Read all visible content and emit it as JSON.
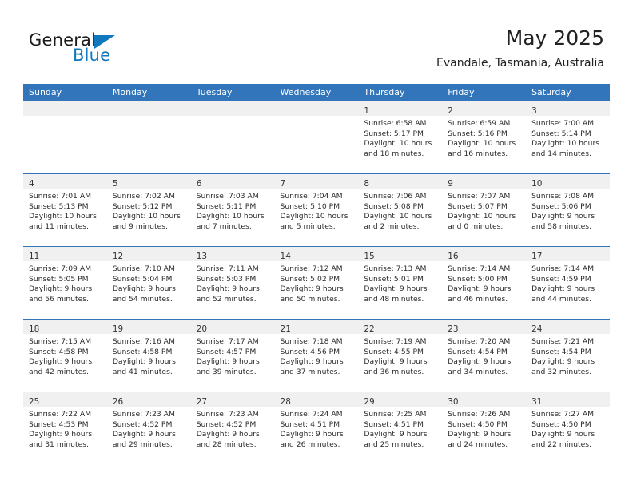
{
  "brand": {
    "name_top": "General",
    "name_bottom": "Blue",
    "accent_color": "#1278be",
    "triangle_icon": "triangle-logo-icon"
  },
  "header": {
    "title": "May 2025",
    "subtitle": "Evandale, Tasmania, Australia"
  },
  "theme": {
    "header_bg": "#3275ba",
    "header_text": "#ffffff",
    "daynum_band_bg": "#f0f0f0",
    "cell_bg": "#ffffff",
    "week_separator": "#3275ba"
  },
  "weekday_headers": [
    "Sunday",
    "Monday",
    "Tuesday",
    "Wednesday",
    "Thursday",
    "Friday",
    "Saturday"
  ],
  "labels": {
    "sunrise_prefix": "Sunrise: ",
    "sunset_prefix": "Sunset: ",
    "daylight_prefix": "Daylight: "
  },
  "weeks": [
    [
      {
        "day": "",
        "empty": true
      },
      {
        "day": "",
        "empty": true
      },
      {
        "day": "",
        "empty": true
      },
      {
        "day": "",
        "empty": true
      },
      {
        "day": "1",
        "sunrise": "Sunrise: 6:58 AM",
        "sunset": "Sunset: 5:17 PM",
        "daylight_1": "Daylight: 10 hours",
        "daylight_2": "and 18 minutes."
      },
      {
        "day": "2",
        "sunrise": "Sunrise: 6:59 AM",
        "sunset": "Sunset: 5:16 PM",
        "daylight_1": "Daylight: 10 hours",
        "daylight_2": "and 16 minutes."
      },
      {
        "day": "3",
        "sunrise": "Sunrise: 7:00 AM",
        "sunset": "Sunset: 5:14 PM",
        "daylight_1": "Daylight: 10 hours",
        "daylight_2": "and 14 minutes."
      }
    ],
    [
      {
        "day": "4",
        "sunrise": "Sunrise: 7:01 AM",
        "sunset": "Sunset: 5:13 PM",
        "daylight_1": "Daylight: 10 hours",
        "daylight_2": "and 11 minutes."
      },
      {
        "day": "5",
        "sunrise": "Sunrise: 7:02 AM",
        "sunset": "Sunset: 5:12 PM",
        "daylight_1": "Daylight: 10 hours",
        "daylight_2": "and 9 minutes."
      },
      {
        "day": "6",
        "sunrise": "Sunrise: 7:03 AM",
        "sunset": "Sunset: 5:11 PM",
        "daylight_1": "Daylight: 10 hours",
        "daylight_2": "and 7 minutes."
      },
      {
        "day": "7",
        "sunrise": "Sunrise: 7:04 AM",
        "sunset": "Sunset: 5:10 PM",
        "daylight_1": "Daylight: 10 hours",
        "daylight_2": "and 5 minutes."
      },
      {
        "day": "8",
        "sunrise": "Sunrise: 7:06 AM",
        "sunset": "Sunset: 5:08 PM",
        "daylight_1": "Daylight: 10 hours",
        "daylight_2": "and 2 minutes."
      },
      {
        "day": "9",
        "sunrise": "Sunrise: 7:07 AM",
        "sunset": "Sunset: 5:07 PM",
        "daylight_1": "Daylight: 10 hours",
        "daylight_2": "and 0 minutes."
      },
      {
        "day": "10",
        "sunrise": "Sunrise: 7:08 AM",
        "sunset": "Sunset: 5:06 PM",
        "daylight_1": "Daylight: 9 hours",
        "daylight_2": "and 58 minutes."
      }
    ],
    [
      {
        "day": "11",
        "sunrise": "Sunrise: 7:09 AM",
        "sunset": "Sunset: 5:05 PM",
        "daylight_1": "Daylight: 9 hours",
        "daylight_2": "and 56 minutes."
      },
      {
        "day": "12",
        "sunrise": "Sunrise: 7:10 AM",
        "sunset": "Sunset: 5:04 PM",
        "daylight_1": "Daylight: 9 hours",
        "daylight_2": "and 54 minutes."
      },
      {
        "day": "13",
        "sunrise": "Sunrise: 7:11 AM",
        "sunset": "Sunset: 5:03 PM",
        "daylight_1": "Daylight: 9 hours",
        "daylight_2": "and 52 minutes."
      },
      {
        "day": "14",
        "sunrise": "Sunrise: 7:12 AM",
        "sunset": "Sunset: 5:02 PM",
        "daylight_1": "Daylight: 9 hours",
        "daylight_2": "and 50 minutes."
      },
      {
        "day": "15",
        "sunrise": "Sunrise: 7:13 AM",
        "sunset": "Sunset: 5:01 PM",
        "daylight_1": "Daylight: 9 hours",
        "daylight_2": "and 48 minutes."
      },
      {
        "day": "16",
        "sunrise": "Sunrise: 7:14 AM",
        "sunset": "Sunset: 5:00 PM",
        "daylight_1": "Daylight: 9 hours",
        "daylight_2": "and 46 minutes."
      },
      {
        "day": "17",
        "sunrise": "Sunrise: 7:14 AM",
        "sunset": "Sunset: 4:59 PM",
        "daylight_1": "Daylight: 9 hours",
        "daylight_2": "and 44 minutes."
      }
    ],
    [
      {
        "day": "18",
        "sunrise": "Sunrise: 7:15 AM",
        "sunset": "Sunset: 4:58 PM",
        "daylight_1": "Daylight: 9 hours",
        "daylight_2": "and 42 minutes."
      },
      {
        "day": "19",
        "sunrise": "Sunrise: 7:16 AM",
        "sunset": "Sunset: 4:58 PM",
        "daylight_1": "Daylight: 9 hours",
        "daylight_2": "and 41 minutes."
      },
      {
        "day": "20",
        "sunrise": "Sunrise: 7:17 AM",
        "sunset": "Sunset: 4:57 PM",
        "daylight_1": "Daylight: 9 hours",
        "daylight_2": "and 39 minutes."
      },
      {
        "day": "21",
        "sunrise": "Sunrise: 7:18 AM",
        "sunset": "Sunset: 4:56 PM",
        "daylight_1": "Daylight: 9 hours",
        "daylight_2": "and 37 minutes."
      },
      {
        "day": "22",
        "sunrise": "Sunrise: 7:19 AM",
        "sunset": "Sunset: 4:55 PM",
        "daylight_1": "Daylight: 9 hours",
        "daylight_2": "and 36 minutes."
      },
      {
        "day": "23",
        "sunrise": "Sunrise: 7:20 AM",
        "sunset": "Sunset: 4:54 PM",
        "daylight_1": "Daylight: 9 hours",
        "daylight_2": "and 34 minutes."
      },
      {
        "day": "24",
        "sunrise": "Sunrise: 7:21 AM",
        "sunset": "Sunset: 4:54 PM",
        "daylight_1": "Daylight: 9 hours",
        "daylight_2": "and 32 minutes."
      }
    ],
    [
      {
        "day": "25",
        "sunrise": "Sunrise: 7:22 AM",
        "sunset": "Sunset: 4:53 PM",
        "daylight_1": "Daylight: 9 hours",
        "daylight_2": "and 31 minutes."
      },
      {
        "day": "26",
        "sunrise": "Sunrise: 7:23 AM",
        "sunset": "Sunset: 4:52 PM",
        "daylight_1": "Daylight: 9 hours",
        "daylight_2": "and 29 minutes."
      },
      {
        "day": "27",
        "sunrise": "Sunrise: 7:23 AM",
        "sunset": "Sunset: 4:52 PM",
        "daylight_1": "Daylight: 9 hours",
        "daylight_2": "and 28 minutes."
      },
      {
        "day": "28",
        "sunrise": "Sunrise: 7:24 AM",
        "sunset": "Sunset: 4:51 PM",
        "daylight_1": "Daylight: 9 hours",
        "daylight_2": "and 26 minutes."
      },
      {
        "day": "29",
        "sunrise": "Sunrise: 7:25 AM",
        "sunset": "Sunset: 4:51 PM",
        "daylight_1": "Daylight: 9 hours",
        "daylight_2": "and 25 minutes."
      },
      {
        "day": "30",
        "sunrise": "Sunrise: 7:26 AM",
        "sunset": "Sunset: 4:50 PM",
        "daylight_1": "Daylight: 9 hours",
        "daylight_2": "and 24 minutes."
      },
      {
        "day": "31",
        "sunrise": "Sunrise: 7:27 AM",
        "sunset": "Sunset: 4:50 PM",
        "daylight_1": "Daylight: 9 hours",
        "daylight_2": "and 22 minutes."
      }
    ]
  ]
}
